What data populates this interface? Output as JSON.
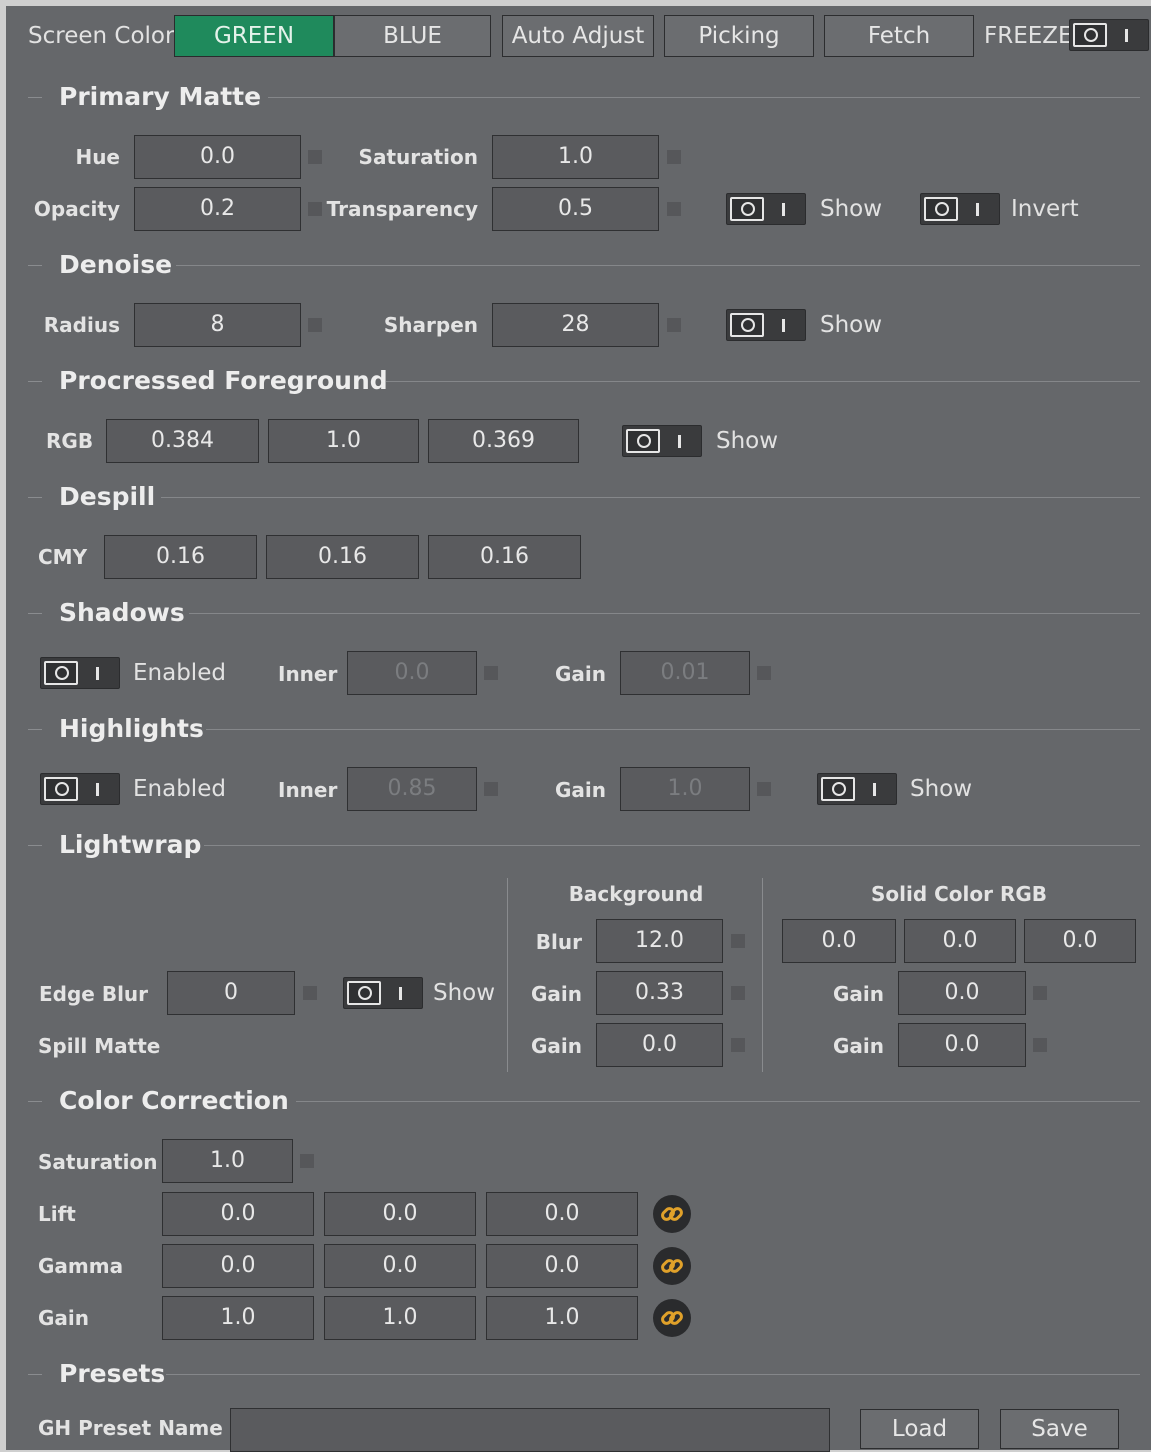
{
  "header": {
    "screen_color_label": "Screen Color",
    "screen_color_options": [
      "GREEN",
      "BLUE"
    ],
    "screen_color_selected": "GREEN",
    "auto_adjust_label": "Auto Adjust",
    "picking_label": "Picking",
    "fetch_label": "Fetch",
    "freeze_label": "FREEZE"
  },
  "primary_matte": {
    "title": "Primary Matte",
    "hue_label": "Hue",
    "hue": "0.0",
    "saturation_label": "Saturation",
    "saturation": "1.0",
    "opacity_label": "Opacity",
    "opacity": "0.2",
    "transparency_label": "Transparency",
    "transparency": "0.5",
    "show_label": "Show",
    "invert_label": "Invert"
  },
  "denoise": {
    "title": "Denoise",
    "radius_label": "Radius",
    "radius": "8",
    "sharpen_label": "Sharpen",
    "sharpen": "28",
    "show_label": "Show"
  },
  "processed_foreground": {
    "title": "Procressed Foreground",
    "rgb_label": "RGB",
    "rgb": [
      "0.384",
      "1.0",
      "0.369"
    ],
    "show_label": "Show"
  },
  "despill": {
    "title": "Despill",
    "cmy_label": "CMY",
    "cmy": [
      "0.16",
      "0.16",
      "0.16"
    ]
  },
  "shadows": {
    "title": "Shadows",
    "enabled_label": "Enabled",
    "inner_label": "Inner",
    "inner": "0.0",
    "gain_label": "Gain",
    "gain": "0.01"
  },
  "highlights": {
    "title": "Highlights",
    "enabled_label": "Enabled",
    "inner_label": "Inner",
    "inner": "0.85",
    "gain_label": "Gain",
    "gain": "1.0",
    "show_label": "Show"
  },
  "lightwrap": {
    "title": "Lightwrap",
    "edge_blur_label": "Edge Blur",
    "edge_blur": "0",
    "show_label": "Show",
    "spill_matte_label": "Spill Matte",
    "background_header": "Background",
    "blur_label": "Blur",
    "blur": "12.0",
    "bg_gain_label_1": "Gain",
    "bg_gain_1": "0.33",
    "bg_gain_label_2": "Gain",
    "bg_gain_2": "0.0",
    "solid_header": "Solid Color RGB",
    "solid_rgb": [
      "0.0",
      "0.0",
      "0.0"
    ],
    "solid_gain_label_1": "Gain",
    "solid_gain_1": "0.0",
    "solid_gain_label_2": "Gain",
    "solid_gain_2": "0.0"
  },
  "color_correction": {
    "title": "Color Correction",
    "saturation_label": "Saturation",
    "saturation": "1.0",
    "lift_label": "Lift",
    "lift": [
      "0.0",
      "0.0",
      "0.0"
    ],
    "gamma_label": "Gamma",
    "gamma": [
      "0.0",
      "0.0",
      "0.0"
    ],
    "gain_label": "Gain",
    "gain": [
      "1.0",
      "1.0",
      "1.0"
    ]
  },
  "presets": {
    "title": "Presets",
    "name_label": "GH Preset Name",
    "name_value": "",
    "load_label": "Load",
    "save_label": "Save"
  },
  "colors": {
    "panel_bg": "#65676a",
    "field_bg": "#5a5b5e",
    "accent_green": "#1f8a5c",
    "link_icon": "#e0a12a"
  }
}
